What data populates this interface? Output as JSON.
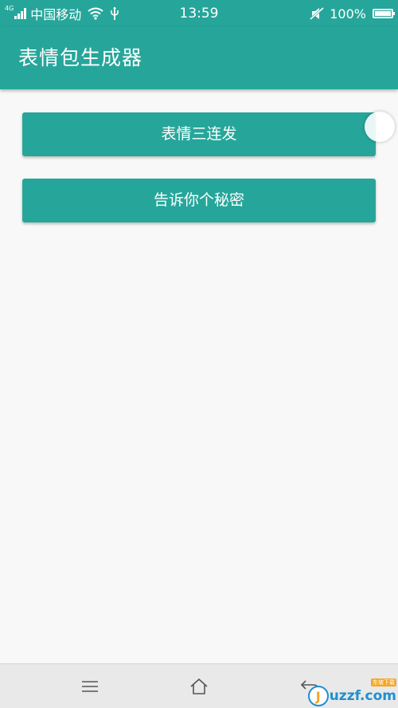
{
  "status_bar": {
    "network_type": "4G",
    "carrier": "中国移动",
    "time": "13:59",
    "battery_percent": "100%",
    "battery_level": 1.0,
    "icons": [
      "signal-icon",
      "wifi-icon",
      "usb-icon",
      "mute-icon",
      "battery-icon"
    ]
  },
  "app_bar": {
    "title": "表情包生成器"
  },
  "main": {
    "buttons": [
      {
        "label": "表情三连发"
      },
      {
        "label": "告诉你个秘密"
      }
    ]
  },
  "nav_bar": {
    "icons": [
      "menu-icon",
      "home-icon",
      "back-icon"
    ]
  },
  "watermark": {
    "logo_letter": "J",
    "text": "uzzf.com",
    "tag": "东坡下载"
  },
  "colors": {
    "primary": "#26a69a",
    "background": "#f8f8f8",
    "nav_bar": "#e9e9e9"
  }
}
